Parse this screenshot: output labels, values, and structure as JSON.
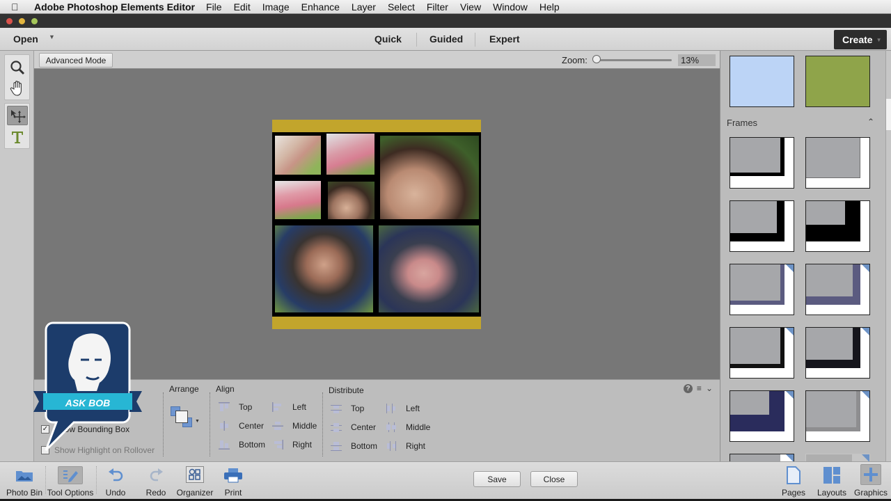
{
  "menubar": {
    "app_name": "Adobe Photoshop Elements Editor",
    "items": [
      "File",
      "Edit",
      "Image",
      "Enhance",
      "Layer",
      "Select",
      "Filter",
      "View",
      "Window",
      "Help"
    ]
  },
  "appbar": {
    "open_label": "Open",
    "modes": [
      "Quick",
      "Guided",
      "Expert"
    ],
    "create_label": "Create"
  },
  "tools": [
    "zoom-tool",
    "hand-tool",
    "move-tool",
    "type-tool"
  ],
  "options_bar": {
    "advanced_mode_label": "Advanced Mode",
    "zoom_label": "Zoom:",
    "zoom_value": "13%",
    "zoom_fraction": 0.13
  },
  "document": {
    "band_color": "#c2a52c",
    "photos": [
      "girl-closeup",
      "girl-running-1",
      "boy-closeup-large",
      "girl-running-2",
      "boy-smiling-small",
      "boy-laughing",
      "family-on-grass"
    ]
  },
  "right_panel": {
    "backgrounds": [
      {
        "name": "light-blue",
        "color": "#bcd4f6"
      },
      {
        "name": "olive-green",
        "color": "#8fa44a"
      }
    ],
    "frames_header": "Frames",
    "frames": [
      "black-drop-shadow",
      "gray-drop-shadow",
      "black-thick-corner",
      "black-wide-corner",
      "purple-shadow",
      "purple-wide-shadow",
      "black-thin-shadow",
      "black-wide-shadow",
      "navy-thick-corner",
      "gray-soft-shadow"
    ]
  },
  "tool_options": {
    "show_bounding_box_label": "Show Bounding Box",
    "show_bounding_box_checked": true,
    "show_highlight_label": "Show Highlight on Rollover",
    "show_highlight_checked": false,
    "arrange_label": "Arrange",
    "align_label": "Align",
    "align_items": [
      "Top",
      "Center",
      "Bottom",
      "Left",
      "Middle",
      "Right"
    ],
    "distribute_label": "Distribute",
    "distribute_items": [
      "Top",
      "Center",
      "Bottom",
      "Left",
      "Middle",
      "Right"
    ]
  },
  "overlay": {
    "ask_bob_label": "ASK BOB"
  },
  "taskbar": {
    "left_items": [
      "Photo Bin",
      "Tool Options",
      "Undo",
      "Redo",
      "Organizer",
      "Print"
    ],
    "save_label": "Save",
    "close_label": "Close",
    "right_items": [
      "Pages",
      "Layouts",
      "Graphics"
    ]
  }
}
